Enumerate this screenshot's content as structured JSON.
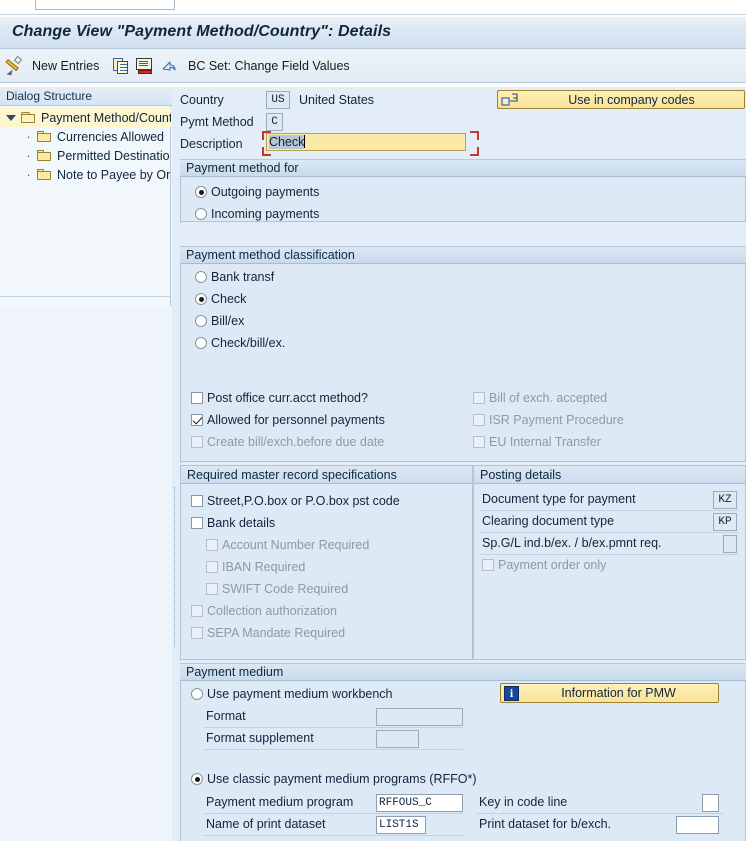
{
  "window": {
    "title": "Change View \"Payment Method/Country\": Details"
  },
  "toolbar": {
    "items": [
      {
        "name": "display-change-icon",
        "label": ""
      },
      {
        "name": "new-entries",
        "label": "New Entries"
      },
      {
        "name": "copy-icon",
        "label": ""
      },
      {
        "name": "save-icon",
        "label": ""
      },
      {
        "name": "undo-icon",
        "label": ""
      },
      {
        "name": "bc-set",
        "label": "BC Set: Change Field Values"
      }
    ],
    "new_entries_label": "New Entries",
    "bc_set_label": "BC Set: Change Field Values"
  },
  "sidebar": {
    "header": "Dialog Structure",
    "items": [
      {
        "label": "Payment Method/Count",
        "selected": true
      },
      {
        "label": "Currencies Allowed",
        "selected": false
      },
      {
        "label": "Permitted Destinatio",
        "selected": false
      },
      {
        "label": "Note to Payee by Or",
        "selected": false
      }
    ]
  },
  "header_fields": {
    "country_label": "Country",
    "country_value": "US",
    "country_text": "United States",
    "pymt_method_label": "Pymt Method",
    "pymt_method_value": "C",
    "description_label": "Description",
    "description_value": "Check",
    "use_in_company_codes_button": "Use in company codes"
  },
  "payment_method_for": {
    "title": "Payment method for",
    "options": [
      {
        "label": "Outgoing payments",
        "selected": true
      },
      {
        "label": "Incoming payments",
        "selected": false
      }
    ]
  },
  "payment_method_classification": {
    "title": "Payment method classification",
    "options": [
      {
        "label": "Bank transf",
        "selected": false
      },
      {
        "label": "Check",
        "selected": true
      },
      {
        "label": "Bill/ex",
        "selected": false
      },
      {
        "label": "Check/bill/ex.",
        "selected": false
      }
    ],
    "checkboxes_left": [
      {
        "label": "Post office curr.acct method?",
        "checked": false,
        "disabled": false
      },
      {
        "label": "Allowed for personnel payments",
        "checked": true,
        "disabled": false
      },
      {
        "label": "Create bill/exch.before due date",
        "checked": false,
        "disabled": true
      }
    ],
    "checkboxes_right": [
      {
        "label": "Bill of exch. accepted",
        "checked": false,
        "disabled": true
      },
      {
        "label": "ISR Payment Procedure",
        "checked": false,
        "disabled": true
      },
      {
        "label": "EU Internal Transfer",
        "checked": false,
        "disabled": true
      }
    ]
  },
  "required_master_record": {
    "title": "Required master record specifications",
    "checkboxes": [
      {
        "label": "Street,P.O.box or P.O.box pst code",
        "checked": false,
        "disabled": false,
        "indent": 0
      },
      {
        "label": "Bank details",
        "checked": false,
        "disabled": false,
        "indent": 0
      },
      {
        "label": "Account Number Required",
        "checked": false,
        "disabled": true,
        "indent": 1
      },
      {
        "label": "IBAN Required",
        "checked": false,
        "disabled": true,
        "indent": 1
      },
      {
        "label": "SWIFT Code Required",
        "checked": false,
        "disabled": true,
        "indent": 1
      },
      {
        "label": "Collection authorization",
        "checked": false,
        "disabled": true,
        "indent": 0
      },
      {
        "label": "SEPA Mandate Required",
        "checked": false,
        "disabled": true,
        "indent": 0
      }
    ]
  },
  "posting_details": {
    "title": "Posting details",
    "rows": [
      {
        "label": "Document type for payment",
        "value": "KZ"
      },
      {
        "label": "Clearing document type",
        "value": "KP"
      },
      {
        "label": "Sp.G/L ind.b/ex. / b/ex.pmnt req.",
        "value": ""
      }
    ],
    "checkbox": {
      "label": "Payment order only",
      "checked": false,
      "disabled": true
    }
  },
  "payment_medium": {
    "title": "Payment medium",
    "workbench_option": {
      "label": "Use payment medium workbench",
      "selected": false
    },
    "format_label": "Format",
    "format_value": "",
    "format_supplement_label": "Format supplement",
    "format_supplement_value": "",
    "information_pmw_button": "Information for PMW",
    "classic_option": {
      "label": "Use classic payment medium programs (RFFO*)",
      "selected": true
    },
    "payment_medium_program_label": "Payment medium program",
    "payment_medium_program_value": "RFFOUS_C",
    "name_of_print_dataset_label": "Name of print dataset",
    "name_of_print_dataset_value": "LIST1S",
    "key_in_code_line_label": "Key in code line",
    "key_in_code_line_value": "",
    "print_dataset_bexch_label": "Print dataset for b/exch.",
    "print_dataset_bexch_value": ""
  },
  "colors": {
    "title_text": "#11263d",
    "panel_bg": "#e3edf7",
    "accent_yellow": "#fbe9a6",
    "focus_red": "#c0392b"
  }
}
